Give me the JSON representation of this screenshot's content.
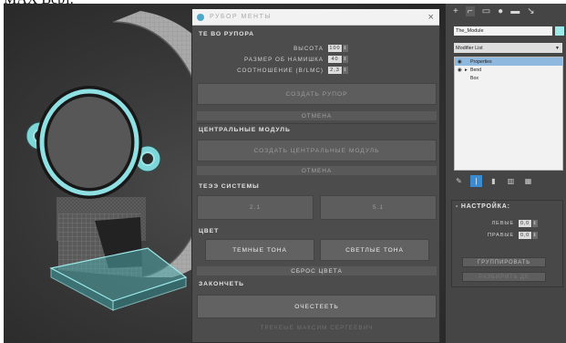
{
  "caption": "МАХ Всрт.",
  "panel": {
    "title": "РУБОР МЕНТЫ",
    "close_glyph": "×",
    "sections": {
      "rupor": "ТЕ ВО РУПОРА",
      "central": "ЦЕНТРАЛЬНЫЕ МОДУЛЬ",
      "system": "ТЕЭЭ СИСТЕМЫ",
      "color": "ЦВЕТ",
      "finish": "ЗАКОНЧЕТЬ"
    },
    "params": {
      "height_label": "ВЫСОТА",
      "height_value": "100",
      "size_label": "РАЗМЕР ОБ НАМИШКА",
      "size_value": "40",
      "ratio_label": "СООТНОШЕНИЕ (В/LMC)",
      "ratio_value": "2,3"
    },
    "buttons": {
      "create_rupor": "СОЗДАТЬ РУПОР",
      "cancel1": "ОТМЕНА",
      "create_central": "СОЗДАТЬ ЦЕНТРАЛЬНЫЕ МОДУЛЬ",
      "cancel2": "ОТМЕНА",
      "sys_a": "2.1",
      "sys_b": "5.1",
      "dark": "ТЕМНЫЕ ТОНА",
      "light": "СВЕТЛЫЕ ТОНА",
      "reset_color": "СБРОС ЦВЕТА",
      "clear": "ОЧЕСТЕЕТЬ",
      "footer": "ТРЕКЕЫЕ МАКСИМ СЕРГЕЕВИЧ"
    }
  },
  "command_panel": {
    "tab_icons": [
      "+",
      "⌐",
      "▭",
      "●",
      "▬",
      "↘"
    ],
    "object_name": "The_Module",
    "object_color": "#9ee9ea",
    "modifier_list": "Modifier List",
    "stack": [
      {
        "eye": "◉",
        "expand": "",
        "label": "Properties",
        "selected": true
      },
      {
        "eye": "◉",
        "expand": "▸",
        "label": "Bend",
        "selected": false
      },
      {
        "eye": "",
        "expand": "",
        "label": "Box",
        "selected": false
      }
    ],
    "rollout": {
      "title": "НАСТРОЙКА:",
      "left_label": "ЛЕВЫЕ",
      "left_value": "0,0",
      "right_label": "ПРАВЫЕ",
      "right_value": "0,0",
      "group_btn": "ГРУППИРОВАТЬ",
      "ungroup_btn": "РАЗБИРИТЬ ДЕ"
    }
  }
}
